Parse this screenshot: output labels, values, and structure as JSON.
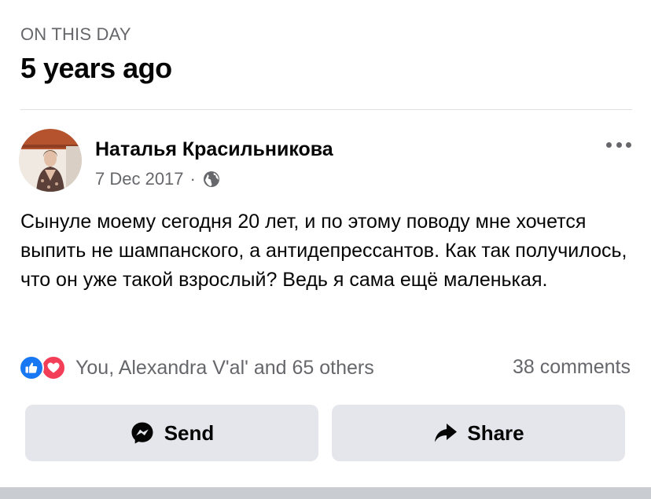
{
  "header": {
    "kicker": "ON THIS DAY",
    "title": "5 years ago"
  },
  "post": {
    "author": "Наталья Красильникова",
    "date": "7 Dec 2017",
    "separator": "·",
    "privacy_icon": "globe-icon",
    "more_icon": "more-horizontal-icon",
    "text": "Сынуле моему сегодня 20 лет, и по этому поводу мне хочется выпить не шампанского, а антидепрессантов. Как так получилось, что он уже такой взрослый? Ведь я сама ещё маленькая."
  },
  "engagement": {
    "reaction_icons": [
      "like-icon",
      "love-icon"
    ],
    "reactions_text": "You, Alexandra V'al' and 65 others",
    "comments_text": "38 comments"
  },
  "actions": {
    "send_label": "Send",
    "send_icon": "messenger-icon",
    "share_label": "Share",
    "share_icon": "share-arrow-icon"
  },
  "colors": {
    "secondary_text": "#65676b",
    "like_blue": "#1877f2",
    "love_red": "#f33e58",
    "button_bg": "#e4e6eb"
  }
}
